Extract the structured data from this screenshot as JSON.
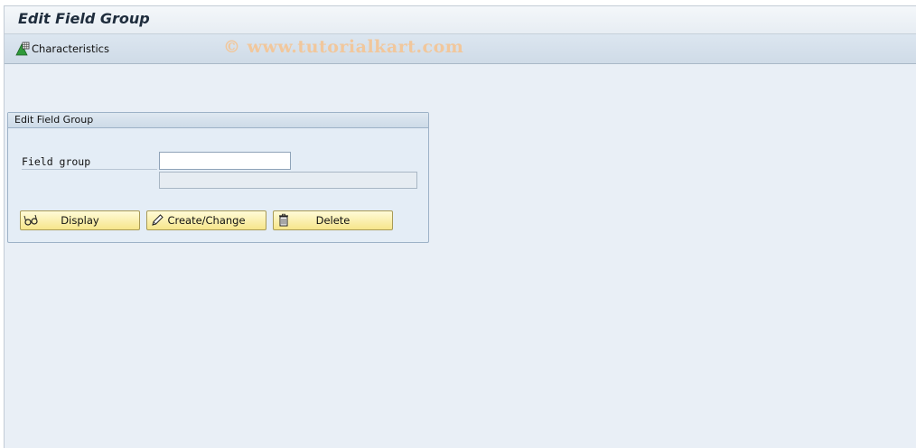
{
  "header": {
    "title": "Edit Field Group"
  },
  "toolbar": {
    "characteristics_label": "Characteristics",
    "characteristics_icon": "characteristics-icon"
  },
  "watermark": "© www.tutorialkart.com",
  "groupbox": {
    "title": "Edit Field Group",
    "field_group_label": "Field group",
    "field_group_value": "",
    "field_group_description": ""
  },
  "buttons": {
    "display": {
      "label": "Display",
      "icon": "glasses-icon"
    },
    "create_change": {
      "label": "Create/Change",
      "icon": "pencil-icon"
    },
    "delete": {
      "label": "Delete",
      "icon": "trash-icon"
    }
  },
  "colors": {
    "accent_button": "#f6e58a",
    "background": "#e9eff6",
    "watermark": "#f1c79c"
  }
}
